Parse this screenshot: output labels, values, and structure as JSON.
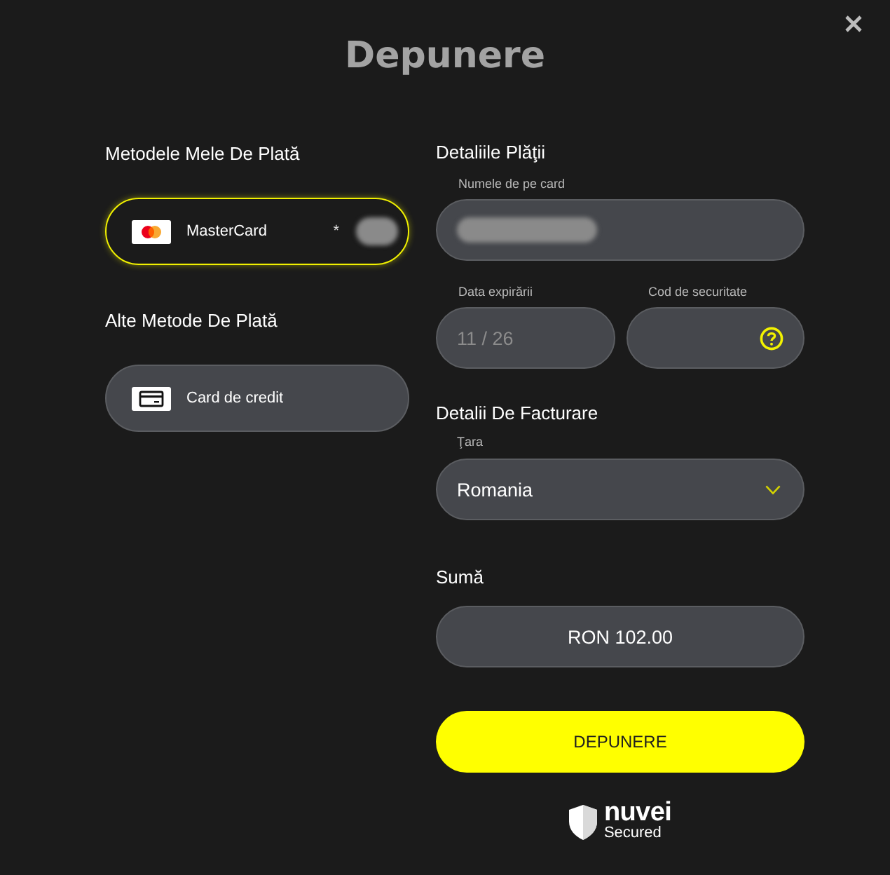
{
  "header": {
    "title": "Depunere"
  },
  "my_methods": {
    "heading": "Metodele Mele De Plată",
    "items": [
      {
        "kind": "mastercard",
        "label": "MasterCard",
        "number": "*",
        "number_redacted": true,
        "selected": true
      }
    ]
  },
  "other_methods": {
    "heading": "Alte Metode De Plată",
    "items": [
      {
        "kind": "credit_card",
        "label": "Card de credit",
        "selected": false
      }
    ]
  },
  "payment_details": {
    "heading": "Detaliile Plăţii",
    "card_name": {
      "label": "Numele de pe card",
      "redacted": true
    },
    "expiry": {
      "label": "Data expirării",
      "value": "11 / 26",
      "disabled": true
    },
    "security_code": {
      "label": "Cod de securitate"
    }
  },
  "billing": {
    "heading": "Detalii De Facturare",
    "country": {
      "label": "Ţara",
      "value": "Romania"
    }
  },
  "amount": {
    "heading": "Sumă",
    "value": "RON 102.00"
  },
  "submit": {
    "label": "DEPUNERE"
  },
  "badge": {
    "brand": "nuvei",
    "caption": "Secured"
  }
}
